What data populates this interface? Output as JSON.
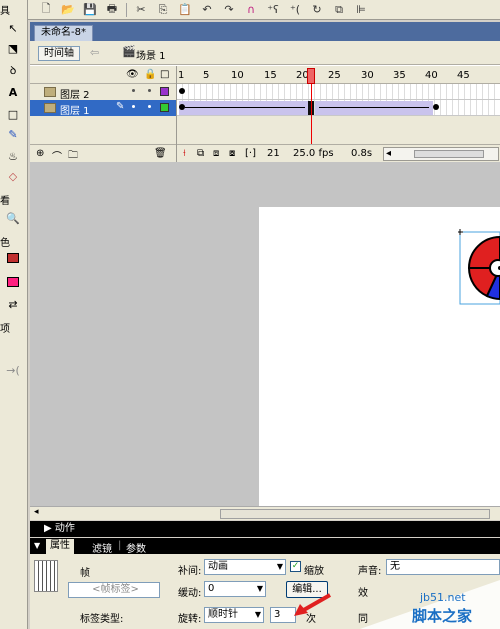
{
  "toolbar_top": {
    "icons": [
      "new-icon",
      "open-icon",
      "save-icon",
      "print-icon",
      "cut-icon",
      "copy-icon",
      "paste-icon",
      "undo-icon",
      "redo-icon",
      "snap-magnet-icon",
      "smooth-icon",
      "straighten-icon",
      "rotate-icon",
      "scale-icon",
      "align-icon"
    ]
  },
  "tools": {
    "section_view": "看",
    "section_color": "色",
    "section_options": "项",
    "section_top": "具"
  },
  "document": {
    "tab_title": "未命名-8*",
    "timeline_button": "时间轴",
    "scene_label": "场景 1"
  },
  "timeline": {
    "ruler_ticks": [
      "1",
      "5",
      "10",
      "15",
      "20",
      "25",
      "30",
      "35",
      "40",
      "45"
    ],
    "current_frame_marker": 20,
    "layers": [
      {
        "name": "图层 2",
        "selected": false,
        "outline_color": "#9933cc"
      },
      {
        "name": "图层 1",
        "selected": true,
        "outline_color": "#33cc33"
      }
    ],
    "current_frame": "21",
    "fps": "25.0 fps",
    "time": "0.8s"
  },
  "panels": {
    "actions_label": "动作",
    "props_tabs": [
      "属性",
      "滤镜",
      "参数"
    ],
    "frame_label": "帧",
    "frame_name_placeholder": "<帧标签>",
    "label_type": "标签类型:",
    "tween_label": "补间:",
    "tween_value": "动画",
    "scale_label": "缩放",
    "scale_checked": true,
    "ease_label": "缓动:",
    "ease_value": "0",
    "edit_button": "编辑...",
    "rotate_label": "旋转:",
    "rotate_value": "顺时针",
    "rotate_times": "3",
    "times_unit": "次",
    "sound_label": "声音:",
    "sound_value": "无",
    "effect_label": "效",
    "sync_label": "同"
  },
  "watermark": {
    "line1": "jb51.net",
    "line2": "脚本之家"
  },
  "colors": {
    "tab_bar": "#4d6b9e",
    "stage_bg": "#c4c4c4",
    "tween_fill": "#c9c3ec",
    "playhead": "#e00000",
    "wheel_red": "#e02020",
    "wheel_blue": "#2030e0"
  }
}
